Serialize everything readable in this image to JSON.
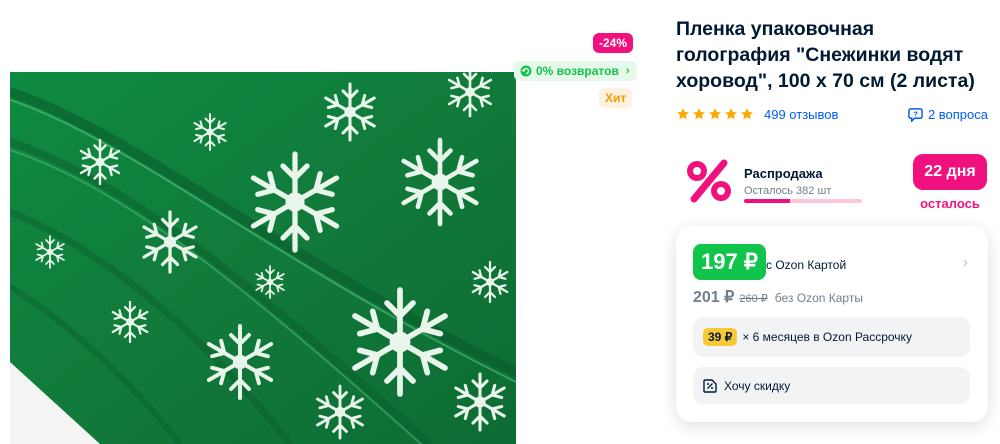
{
  "badges": {
    "discount": "-24%",
    "returns": "0% возвратов",
    "hit": "Хит"
  },
  "product": {
    "title": "Пленка упаковочная голография \"Снежинки водят хоровод\", 100 х 70 см (2 листа)",
    "image_icon": "green-holographic-snowflake-wrapping-film-photo",
    "rating_stars": 5,
    "reviews": "499 отзывов",
    "questions": "2 вопроса"
  },
  "sale": {
    "title": "Распродажа",
    "remaining": "Осталось 382 шт",
    "progress_fraction": 0.39,
    "days": "22 дня",
    "days_caption": "осталось"
  },
  "price": {
    "ozon_card_price": "197 ₽",
    "ozon_card_caption": "с Ozon Картой",
    "regular_price": "201 ₽",
    "old_price": "260 ₽",
    "without_card_caption": "без Ozon Карты",
    "installment_amount": "39 ₽",
    "installment_text": "× 6 месяцев в Ozon Рассрочку",
    "want_discount": "Хочу скидку"
  },
  "colors": {
    "accent_blue": "#005bff",
    "sale_pink": "#f1117e",
    "ozon_green": "#10c44c",
    "star_yellow": "#ffa800",
    "installment_yellow": "#f9c837"
  }
}
